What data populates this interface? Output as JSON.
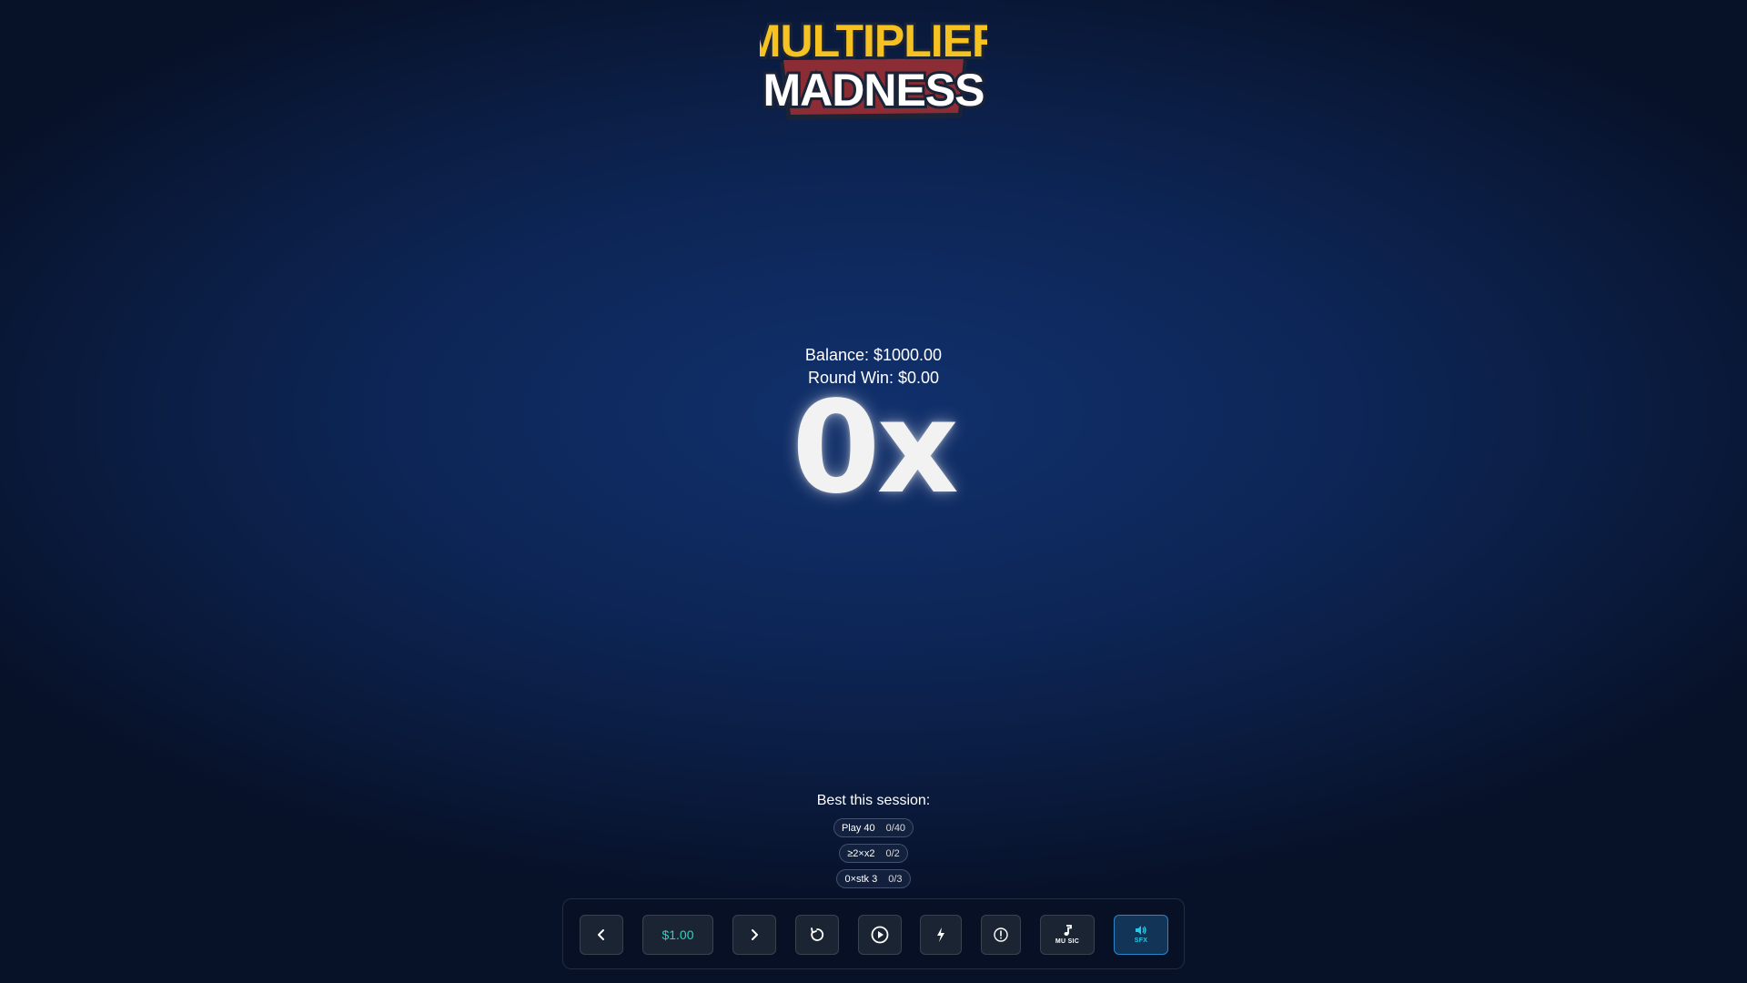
{
  "logo": {
    "line1": "MULTIPLIER",
    "line2": "MADNESS",
    "line1_color": "#f5c222",
    "line2_color": "#ffffff",
    "badge_color": "#8c2d35"
  },
  "stats": {
    "balance": "Balance: $1000.00",
    "round_win": "Round Win: $0.00"
  },
  "multiplier": {
    "display": "0x"
  },
  "session": {
    "title": "Best this session:",
    "challenges": [
      {
        "label": "Play 40",
        "progress": "0/40"
      },
      {
        "label": "≥2×x2",
        "progress": "0/2"
      },
      {
        "label": "0×stk 3",
        "progress": "0/3"
      }
    ]
  },
  "controls": {
    "bet_value": "$1.00",
    "music_label": "MU SIC",
    "sfx_label": "SFX",
    "icons": {
      "prev": "chevron-left-icon",
      "next": "chevron-right-icon",
      "reset": "rotate-icon",
      "play": "play-circle-icon",
      "turbo": "lightning-icon",
      "info": "info-icon",
      "music": "music-note-icon",
      "sfx": "speaker-icon"
    },
    "accent_color": "#29d4c3"
  }
}
